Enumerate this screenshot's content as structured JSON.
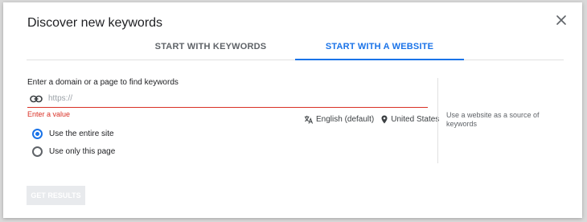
{
  "dialog": {
    "title": "Discover new keywords",
    "close_icon": "close-icon"
  },
  "tabs": [
    {
      "label": "START WITH KEYWORDS",
      "active": false
    },
    {
      "label": "START WITH A WEBSITE",
      "active": true
    }
  ],
  "form": {
    "prompt": "Enter a domain or a page to find keywords",
    "input_value": "",
    "input_placeholder": "https://",
    "input_icon": "link-icon",
    "error": "Enter a value",
    "language": "English (default)",
    "language_icon": "translate-icon",
    "location": "United States",
    "location_icon": "location-pin-icon",
    "options": [
      {
        "label": "Use the entire site",
        "selected": true
      },
      {
        "label": "Use only this page",
        "selected": false
      }
    ]
  },
  "side_panel": {
    "hint": "Use a website as a source of keywords"
  },
  "actions": {
    "get_results_label": "GET RESULTS",
    "get_results_enabled": false
  },
  "colors": {
    "accent": "#1a73e8",
    "error": "#d93025",
    "disabled_button": "#e8eaed"
  }
}
